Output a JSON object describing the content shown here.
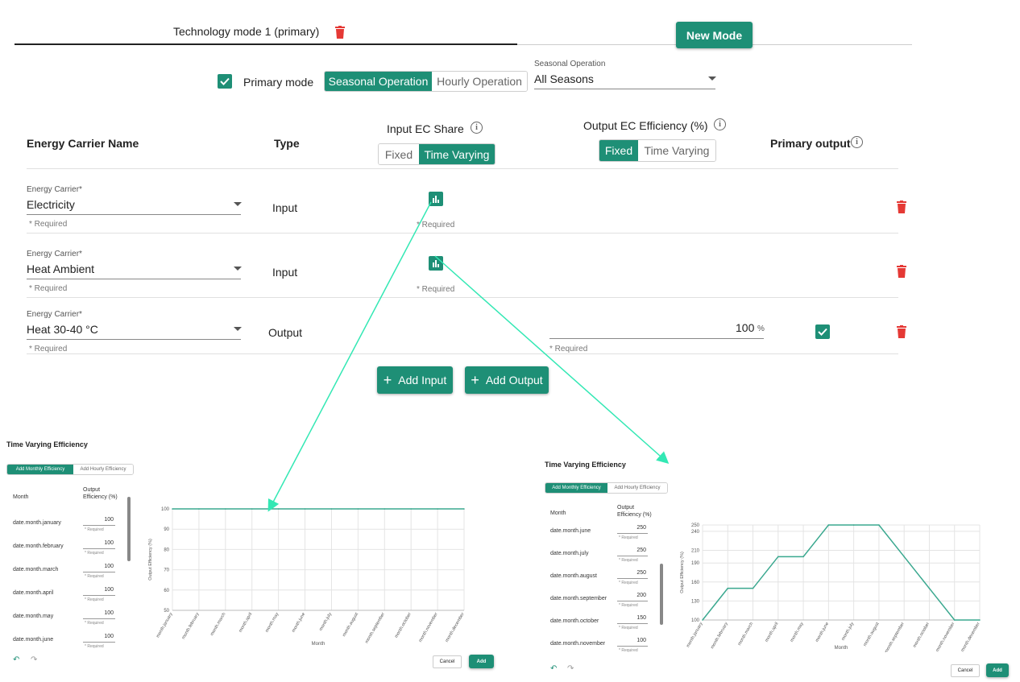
{
  "tabs": {
    "mode1_label": "Technology mode 1 (primary)",
    "new_mode_label": "New Mode"
  },
  "options": {
    "primary_mode_label": "Primary mode",
    "seasonal_btn": "Seasonal Operation",
    "hourly_btn": "Hourly Operation",
    "seasonal_select_label": "Seasonal Operation",
    "seasonal_select_value": "All Seasons"
  },
  "table": {
    "col_name": "Energy Carrier Name",
    "col_type": "Type",
    "col_input_share": "Input EC Share",
    "col_output_eff": "Output EC Efficiency (%)",
    "col_primary": "Primary output",
    "fixed": "Fixed",
    "time_varying": "Time Varying",
    "carrier_label": "Energy Carrier*",
    "required": "* Required",
    "rows": [
      {
        "carrier": "Electricity",
        "type": "Input"
      },
      {
        "carrier": "Heat Ambient",
        "type": "Input"
      },
      {
        "carrier": "Heat 30-40 °C",
        "type": "Output",
        "value": "100",
        "unit": "%"
      }
    ],
    "add_input": "Add Input",
    "add_output": "Add Output"
  },
  "dialog_left": {
    "title": "Time Varying Efficiency",
    "tab_monthly": "Add Monthly Efficiency",
    "tab_hourly": "Add Hourly Efficiency",
    "col_month": "Month",
    "col_eff": "Output Efficiency (%)",
    "required": "* Required",
    "rows": [
      {
        "month": "date.month.january",
        "value": "100"
      },
      {
        "month": "date.month.february",
        "value": "100"
      },
      {
        "month": "date.month.march",
        "value": "100"
      },
      {
        "month": "date.month.april",
        "value": "100"
      },
      {
        "month": "date.month.may",
        "value": "100"
      },
      {
        "month": "date.month.june",
        "value": "100"
      }
    ],
    "cancel": "Cancel",
    "add": "Add"
  },
  "dialog_right": {
    "title": "Time Varying Efficiency",
    "tab_monthly": "Add Monthly Efficiency",
    "tab_hourly": "Add Hourly Efficiency",
    "col_month": "Month",
    "col_eff": "Output Efficiency (%)",
    "required": "* Required",
    "rows": [
      {
        "month": "date.month.june",
        "value": "250"
      },
      {
        "month": "date.month.july",
        "value": "250"
      },
      {
        "month": "date.month.august",
        "value": "250"
      },
      {
        "month": "date.month.september",
        "value": "200"
      },
      {
        "month": "date.month.october",
        "value": "150"
      },
      {
        "month": "date.month.november",
        "value": "100"
      }
    ],
    "cancel": "Cancel",
    "add": "Add"
  },
  "chart_data": [
    {
      "type": "line",
      "title": "",
      "xlabel": "Month",
      "ylabel": "Output Efficiency (%)",
      "categories": [
        "month.january",
        "month.february",
        "month.march",
        "month.april",
        "month.may",
        "month.june",
        "month.july",
        "month.august",
        "month.september",
        "month.october",
        "month.november",
        "month.december"
      ],
      "series": [
        {
          "values": [
            100,
            100,
            100,
            100,
            100,
            100,
            100,
            100,
            100,
            100,
            100,
            100
          ]
        }
      ],
      "ylim": [
        50,
        100
      ],
      "yticks": [
        50,
        60,
        70,
        80,
        90,
        100
      ],
      "grid": true,
      "color": "#3aa88f"
    },
    {
      "type": "line",
      "title": "",
      "xlabel": "Month",
      "ylabel": "Output Efficiency (%)",
      "categories": [
        "month.january",
        "month.february",
        "month.march",
        "month.april",
        "month.may",
        "month.june",
        "month.july",
        "month.august",
        "month.september",
        "month.october",
        "month.november",
        "month.december"
      ],
      "series": [
        {
          "values": [
            100,
            150,
            150,
            200,
            200,
            250,
            250,
            250,
            200,
            150,
            100,
            100
          ]
        }
      ],
      "ylim": [
        100,
        250
      ],
      "yticks": [
        100,
        130,
        160,
        190,
        210,
        240,
        250
      ],
      "grid": true,
      "color": "#3aa88f"
    }
  ],
  "colors": {
    "accent": "#1e8f76",
    "delete": "#e53935",
    "arrow": "#33e8b4"
  }
}
